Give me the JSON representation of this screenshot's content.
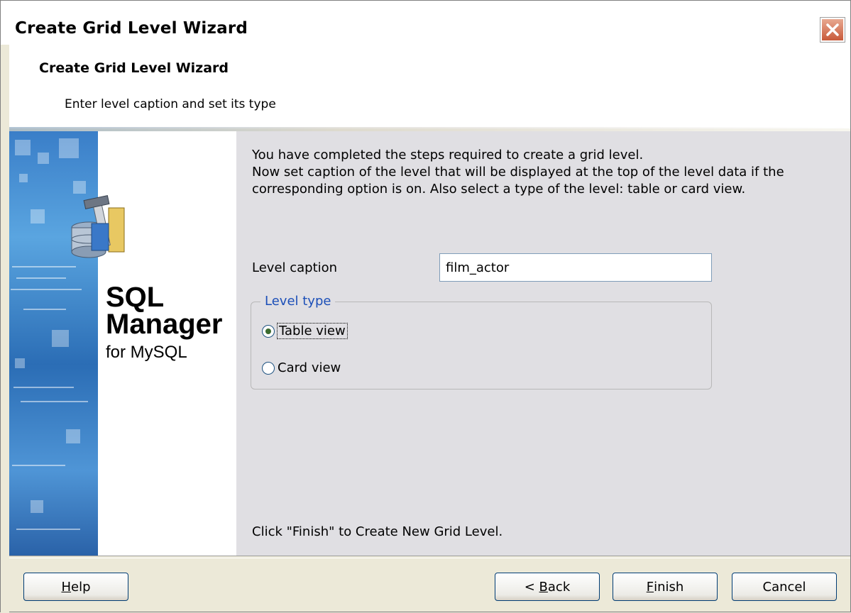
{
  "window": {
    "title": "Create Grid Level Wizard",
    "close_icon": "close-icon"
  },
  "header": {
    "title": "Create Grid Level Wizard",
    "subtitle": "Enter level caption and set its type"
  },
  "banner": {
    "product_line1": "SQL",
    "product_line2": "Manager",
    "product_line3": "for MySQL",
    "icon": "database-tools-icon"
  },
  "content": {
    "description_lines": [
      "You have completed the steps required to create a grid level.",
      "Now set caption of the level that will be displayed at the top of the level data if the",
      "corresponding option is on. Also select a type of the level: table or card view."
    ],
    "level_caption_label": "Level caption",
    "level_caption_value": "film_actor",
    "level_type_legend": "Level type",
    "options": [
      {
        "label": "Table view",
        "selected": true
      },
      {
        "label": "Card view",
        "selected": false
      }
    ],
    "finish_hint": "Click \"Finish\" to Create New Grid Level."
  },
  "footer": {
    "help": {
      "mnemonic": "H",
      "rest": "elp"
    },
    "back": {
      "prefix": "< ",
      "mnemonic": "B",
      "rest": "ack"
    },
    "finish": {
      "mnemonic": "F",
      "rest": "inish"
    },
    "cancel": "Cancel"
  },
  "colors": {
    "legend": "#1c4fb8",
    "content_bg": "#e0dfe3",
    "banner_blue": "#3a7ec8"
  }
}
